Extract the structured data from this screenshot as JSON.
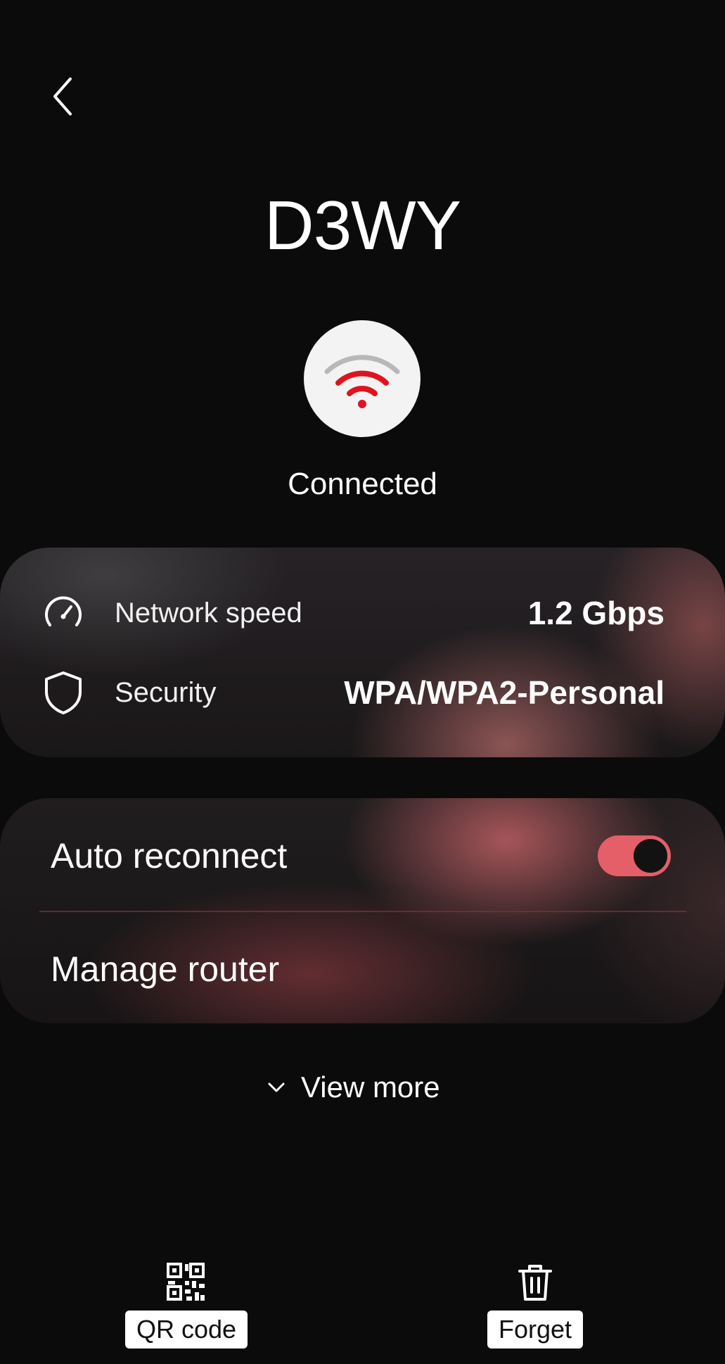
{
  "header": {
    "back_icon": "chevron-left-icon",
    "network_name": "D3WY"
  },
  "status": {
    "icon": "wifi-icon",
    "text": "Connected",
    "accent_color": "#e0141e"
  },
  "info": {
    "speed": {
      "icon": "speedometer-icon",
      "label": "Network speed",
      "value": "1.2 Gbps"
    },
    "security": {
      "icon": "shield-icon",
      "label": "Security",
      "value": "WPA/WPA2-Personal"
    }
  },
  "settings": {
    "auto_reconnect": {
      "label": "Auto reconnect",
      "enabled": true,
      "toggle_color": "#e45f68"
    },
    "manage_router": {
      "label": "Manage router"
    }
  },
  "view_more": {
    "icon": "chevron-down-icon",
    "label": "View more"
  },
  "actions": {
    "qr": {
      "icon": "qr-code-icon",
      "label": "QR code"
    },
    "forget": {
      "icon": "trash-icon",
      "label": "Forget"
    }
  }
}
